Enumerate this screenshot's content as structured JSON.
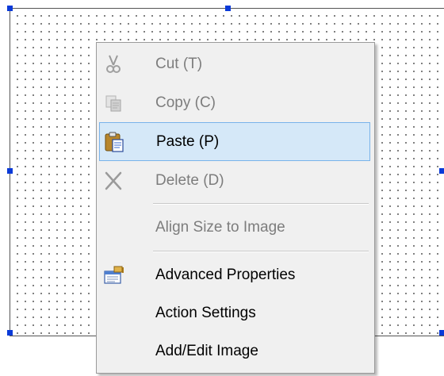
{
  "context_menu": {
    "items": [
      {
        "label": "Cut (T)",
        "enabled": false,
        "icon": "scissors-icon"
      },
      {
        "label": "Copy (C)",
        "enabled": false,
        "icon": "copy-icon"
      },
      {
        "label": "Paste (P)",
        "enabled": true,
        "icon": "clipboard-paste-icon",
        "highlighted": true
      },
      {
        "label": "Delete (D)",
        "enabled": false,
        "icon": "delete-x-icon"
      },
      {
        "label": "Align Size to Image",
        "enabled": false
      },
      {
        "label": "Advanced Properties",
        "enabled": true,
        "icon": "properties-icon"
      },
      {
        "label": "Action Settings",
        "enabled": true
      },
      {
        "label": "Add/Edit Image",
        "enabled": true
      }
    ]
  },
  "colors": {
    "selection_handle": "#0a3ad8",
    "highlight_bg": "#d5e8f8",
    "highlight_border": "#79b3ea",
    "disabled_text": "#7d7d7d"
  }
}
